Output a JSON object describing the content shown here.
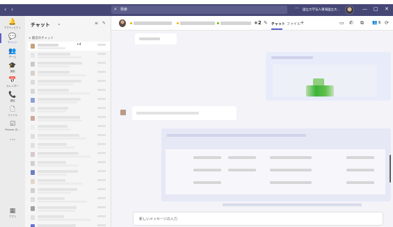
{
  "banner": {
    "text": ""
  },
  "titlebar": {
    "back_icon": "chevron-left",
    "forward_icon": "chevron-right",
    "search_placeholder": "検索",
    "more_label": "···",
    "org_name": "国立大学法人東海国立大...",
    "window_controls": [
      "—",
      "□",
      "✕"
    ]
  },
  "rail": {
    "items": [
      {
        "label": "アクティビティ",
        "icon": "bell-icon",
        "glyph": "🔔",
        "active": false
      },
      {
        "label": "チャット",
        "icon": "chat-icon",
        "glyph": "💬",
        "active": true
      },
      {
        "label": "チーム",
        "icon": "teams-icon",
        "glyph": "👥",
        "active": false
      },
      {
        "label": "課題",
        "icon": "assignments-icon",
        "glyph": "🎓",
        "active": false
      },
      {
        "label": "カレンダー",
        "icon": "calendar-icon",
        "glyph": "📅",
        "active": false
      },
      {
        "label": "通話",
        "icon": "phone-icon",
        "glyph": "📞",
        "active": false
      },
      {
        "label": "ファイル",
        "icon": "file-icon",
        "glyph": "🗋",
        "active": false
      },
      {
        "label": "Planner お...",
        "icon": "planner-icon",
        "glyph": "☑",
        "active": false
      },
      {
        "label": "",
        "icon": "more-apps-icon",
        "glyph": "···",
        "active": false
      }
    ],
    "apps_label": "アプリ",
    "apps_glyph": "▦"
  },
  "chatlist": {
    "title": "チャット",
    "title_chevron": "⌄",
    "filter_icon": "≡",
    "new_chat_icon": "✎",
    "section_label": "∨ 最近のチャット",
    "selected_count": "+4",
    "item_colors": [
      "#c8a07a",
      "#e6e6e6",
      "#c9c9c9",
      "#d8d0c8",
      "#dcdcdc",
      "#d6d6d6",
      "#8aa0d8",
      "#d9d9d9",
      "#d0a89a",
      "#ececec",
      "#dddddd",
      "#e0e0e0",
      "#d8c8c8",
      "#d0d0d0",
      "#6a7fc4",
      "#e2d6c8",
      "#cfcfcf",
      "#dddddd",
      "#a0a0a0",
      "#e0e0e0",
      "#6570c9"
    ]
  },
  "header": {
    "more_members": "+2",
    "tab_chat": "チャット",
    "tab_files": "ファイル",
    "add_tab": "+",
    "video_icon": "▭",
    "call_icon": "✆",
    "screen_share_icon": "⧉",
    "participants_count": "5",
    "popout_icon": "⟳",
    "dot_colors": [
      "#f0b400",
      "#f0b400",
      "#6bb700"
    ]
  },
  "compose": {
    "placeholder": "新しいメッセージの入力"
  }
}
